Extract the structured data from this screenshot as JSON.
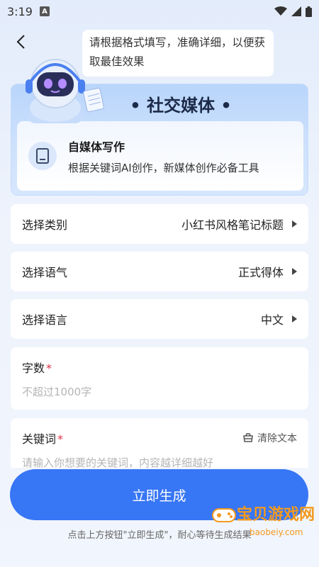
{
  "status_bar": {
    "time": "3:19",
    "notification_icon_letter": "A"
  },
  "header": {
    "hint_text": "请根据格式填写，准确详细，以便获取最佳效果"
  },
  "hero": {
    "category_title": "• 社交媒体 •",
    "tool_name": "自媒体写作",
    "tool_description": "根据关键词AI创作，新媒体创作必备工具"
  },
  "options": [
    {
      "label": "选择类别",
      "value": "小红书风格笔记标题"
    },
    {
      "label": "选择语气",
      "value": "正式得体"
    },
    {
      "label": "选择语言",
      "value": "中文"
    }
  ],
  "word_count": {
    "label": "字数",
    "required_mark": "*",
    "placeholder": "不超过1000字"
  },
  "keywords": {
    "label": "关键词",
    "required_mark": "*",
    "placeholder": "请输入你想要的关键词，内容越详细越好",
    "clear_label": "清除文本"
  },
  "generate_button": "立即生成",
  "footer_note": "点击上方按钮\"立即生成\"，耐心等待生成结果",
  "watermark": {
    "text": "宝贝游戏网",
    "url": "baobeiy.com"
  },
  "colors": {
    "accent": "#3776f5",
    "required": "#e0304a",
    "watermark": "#f39a1f"
  }
}
